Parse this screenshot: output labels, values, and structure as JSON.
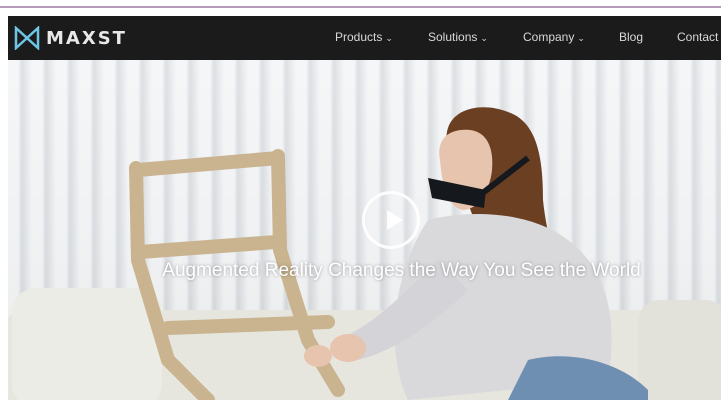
{
  "brand": {
    "logo_text": "MAXST",
    "logo_icon": "maxst-logo-icon",
    "accent_color": "#6ec6e6"
  },
  "nav": {
    "items": [
      {
        "label": "Products",
        "has_caret": true
      },
      {
        "label": "Solutions",
        "has_caret": true
      },
      {
        "label": "Company",
        "has_caret": true
      },
      {
        "label": "Blog",
        "has_caret": false
      },
      {
        "label": "Contact",
        "has_caret": false
      }
    ],
    "caret_glyph": "⌄",
    "background": "#1b1b1b"
  },
  "hero": {
    "tagline": "Augmented Reality Changes the Way You See the World",
    "play_icon": "play-icon"
  }
}
